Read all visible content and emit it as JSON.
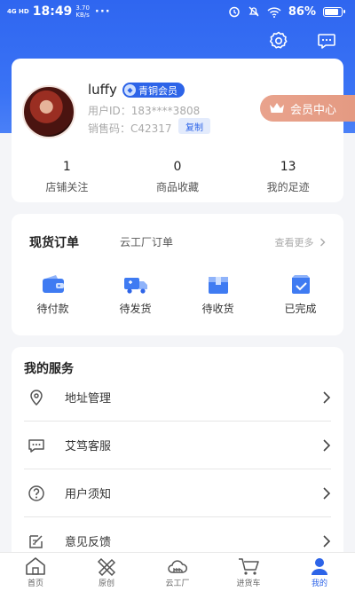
{
  "status_bar": {
    "network": "4G HD",
    "time": "18:49",
    "speed_value": "3.70",
    "speed_unit": "KB/s",
    "dots": "···",
    "battery": "86%",
    "battery_level": 0.86
  },
  "profile": {
    "username": "luffy",
    "member_level": "青铜会员",
    "user_id_label": "用户ID：",
    "user_id": "183****3808",
    "sales_code_label": "销售码：",
    "sales_code": "C42317",
    "copy_label": "复制",
    "vip_center": "会员中心",
    "stats": [
      {
        "value": "1",
        "label": "店铺关注"
      },
      {
        "value": "0",
        "label": "商品收藏"
      },
      {
        "value": "13",
        "label": "我的足迹"
      }
    ]
  },
  "orders": {
    "title": "现货订单",
    "tab2": "云工厂订单",
    "see_more": "查看更多",
    "items": [
      {
        "label": "待付款",
        "icon": "wallet-icon"
      },
      {
        "label": "待发货",
        "icon": "truck-icon"
      },
      {
        "label": "待收货",
        "icon": "box-icon"
      },
      {
        "label": "已完成",
        "icon": "check-bag-icon"
      }
    ]
  },
  "services": {
    "title": "我的服务",
    "items": [
      {
        "label": "地址管理",
        "icon": "location-icon"
      },
      {
        "label": "艾笃客服",
        "icon": "chat-icon"
      },
      {
        "label": "用户须知",
        "icon": "question-icon"
      },
      {
        "label": "意见反馈",
        "icon": "feedback-icon"
      }
    ]
  },
  "tabbar": {
    "items": [
      {
        "label": "首页",
        "icon": "home-icon"
      },
      {
        "label": "原创",
        "icon": "original-icon"
      },
      {
        "label": "云工厂",
        "icon": "cloud-factory-icon"
      },
      {
        "label": "进货车",
        "icon": "cart-icon"
      },
      {
        "label": "我的",
        "icon": "user-icon"
      }
    ],
    "active_index": 4
  },
  "colors": {
    "primary": "#2d64e8",
    "header_bg": "#3a73f5",
    "vip": "#e49a82",
    "page_bg": "#f4f5f8"
  }
}
